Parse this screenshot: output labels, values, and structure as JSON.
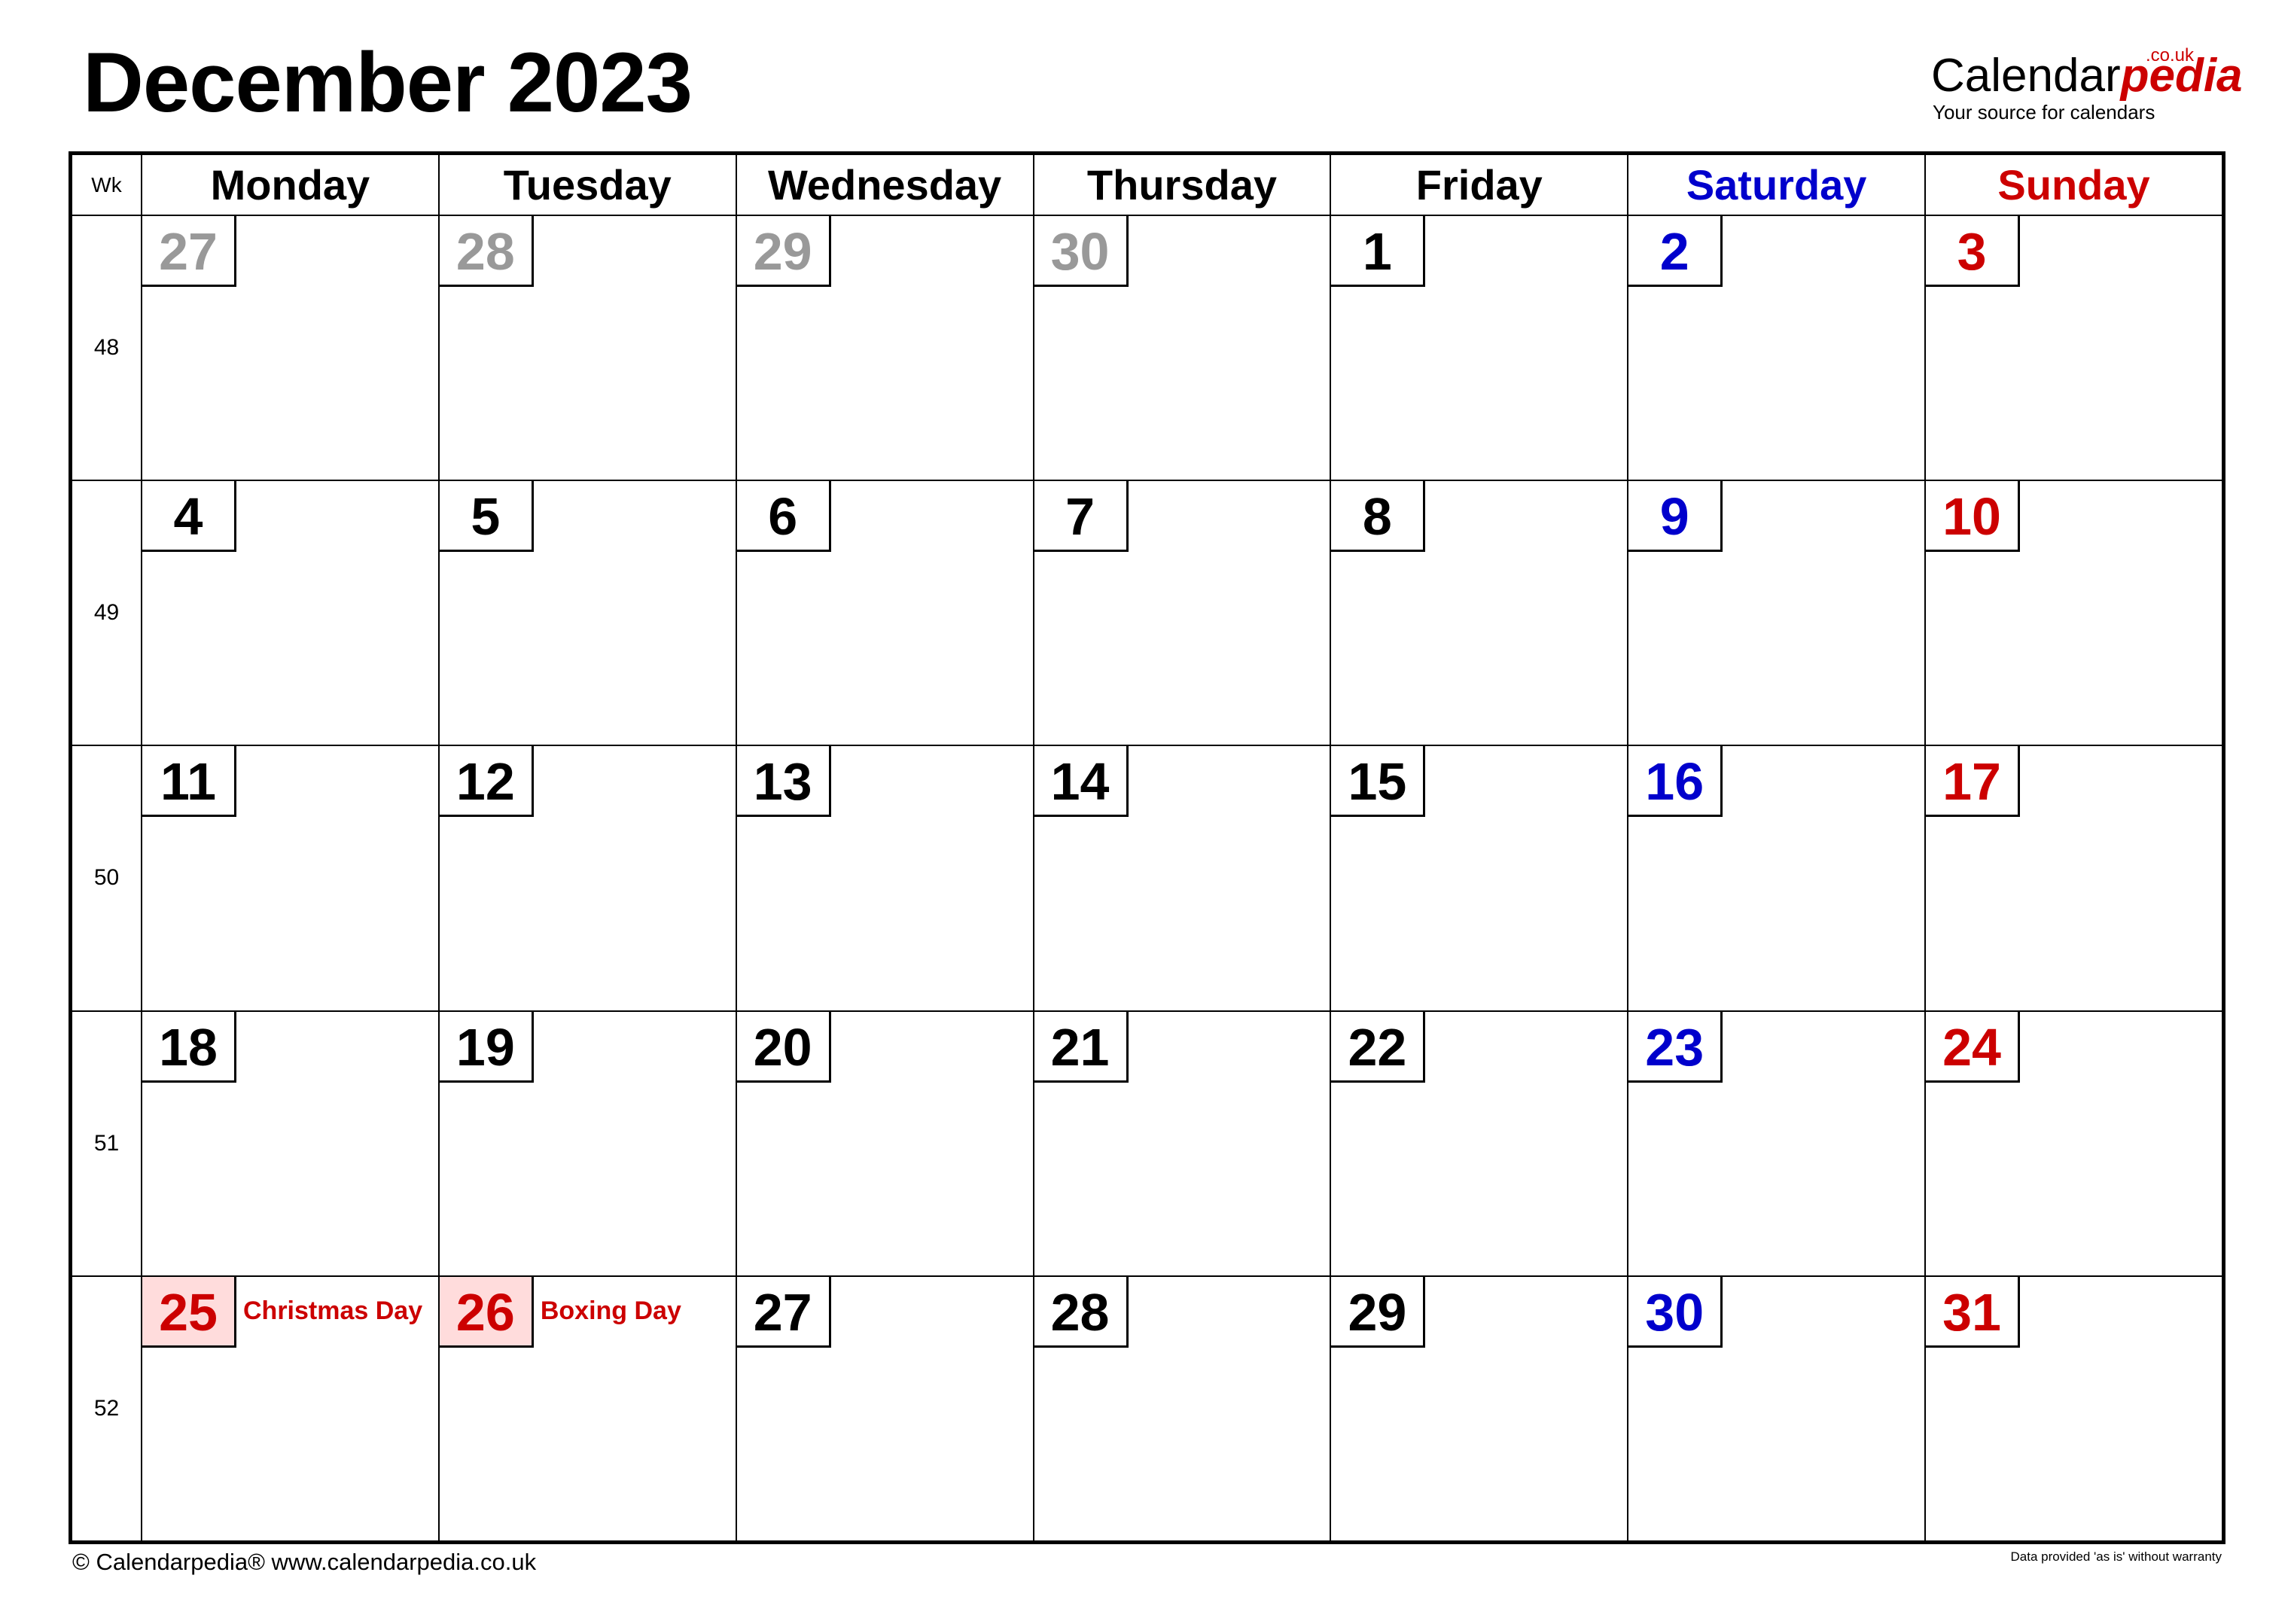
{
  "title": "December 2023",
  "logo": {
    "main": "Calendar",
    "accent": "pedia",
    "suffix": ".co.uk",
    "tagline": "Your source for calendars"
  },
  "colors": {
    "weekday": "#000000",
    "saturday": "#0000cc",
    "sunday": "#cc0000",
    "other_month": "#999999",
    "holiday_text": "#cc0000",
    "holiday_fill": "#ffdcdc"
  },
  "header": {
    "week_label": "Wk",
    "days": [
      "Monday",
      "Tuesday",
      "Wednesday",
      "Thursday",
      "Friday",
      "Saturday",
      "Sunday"
    ]
  },
  "weeks": [
    {
      "wk": "48",
      "days": [
        {
          "d": "27",
          "t": "other"
        },
        {
          "d": "28",
          "t": "other"
        },
        {
          "d": "29",
          "t": "other"
        },
        {
          "d": "30",
          "t": "other"
        },
        {
          "d": "1",
          "t": "weekday"
        },
        {
          "d": "2",
          "t": "saturday"
        },
        {
          "d": "3",
          "t": "sunday"
        }
      ]
    },
    {
      "wk": "49",
      "days": [
        {
          "d": "4",
          "t": "weekday"
        },
        {
          "d": "5",
          "t": "weekday"
        },
        {
          "d": "6",
          "t": "weekday"
        },
        {
          "d": "7",
          "t": "weekday"
        },
        {
          "d": "8",
          "t": "weekday"
        },
        {
          "d": "9",
          "t": "saturday"
        },
        {
          "d": "10",
          "t": "sunday"
        }
      ]
    },
    {
      "wk": "50",
      "days": [
        {
          "d": "11",
          "t": "weekday"
        },
        {
          "d": "12",
          "t": "weekday"
        },
        {
          "d": "13",
          "t": "weekday"
        },
        {
          "d": "14",
          "t": "weekday"
        },
        {
          "d": "15",
          "t": "weekday"
        },
        {
          "d": "16",
          "t": "saturday"
        },
        {
          "d": "17",
          "t": "sunday"
        }
      ]
    },
    {
      "wk": "51",
      "days": [
        {
          "d": "18",
          "t": "weekday"
        },
        {
          "d": "19",
          "t": "weekday"
        },
        {
          "d": "20",
          "t": "weekday"
        },
        {
          "d": "21",
          "t": "weekday"
        },
        {
          "d": "22",
          "t": "weekday"
        },
        {
          "d": "23",
          "t": "saturday"
        },
        {
          "d": "24",
          "t": "sunday"
        }
      ]
    },
    {
      "wk": "52",
      "days": [
        {
          "d": "25",
          "t": "holiday",
          "holiday": "Christmas Day"
        },
        {
          "d": "26",
          "t": "holiday",
          "holiday": "Boxing Day"
        },
        {
          "d": "27",
          "t": "weekday"
        },
        {
          "d": "28",
          "t": "weekday"
        },
        {
          "d": "29",
          "t": "weekday"
        },
        {
          "d": "30",
          "t": "saturday"
        },
        {
          "d": "31",
          "t": "sunday"
        }
      ]
    }
  ],
  "footer": {
    "left": "© Calendarpedia®   www.calendarpedia.co.uk",
    "right": "Data provided 'as is' without warranty"
  }
}
